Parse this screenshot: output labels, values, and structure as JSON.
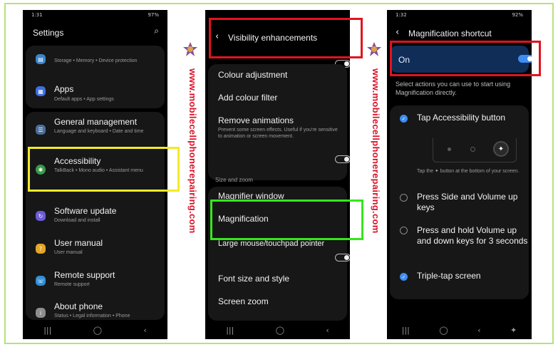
{
  "watermark": "www.mobilecellphonerepairing.com",
  "colors": {
    "highlight_yellow": "#f2ea2a",
    "highlight_green": "#35e61d",
    "highlight_red": "#e0141e",
    "accent_blue": "#3e8df2"
  },
  "phone1": {
    "status_time": "1:31",
    "status_right": "97%",
    "title": "Settings",
    "search_icon": "search-icon",
    "items": [
      {
        "icon": "storage-icon",
        "title": "",
        "subtitle": "Storage • Memory • Device protection",
        "color": "#3c86c9"
      },
      {
        "icon": "apps-icon",
        "title": "Apps",
        "subtitle": "Default apps • App settings",
        "color": "#3d6fe0"
      },
      {
        "icon": "general-management-icon",
        "title": "General management",
        "subtitle": "Language and keyboard • Date and time",
        "color": "#4b6f98"
      },
      {
        "icon": "accessibility-icon",
        "title": "Accessibility",
        "subtitle": "TalkBack • Mono audio • Assistant menu",
        "color": "#3a9a4a"
      },
      {
        "icon": "software-update-icon",
        "title": "Software update",
        "subtitle": "Download and install",
        "color": "#6d5bd6"
      },
      {
        "icon": "user-manual-icon",
        "title": "User manual",
        "subtitle": "User manual",
        "color": "#e5a624"
      },
      {
        "icon": "remote-support-icon",
        "title": "Remote support",
        "subtitle": "Remote support",
        "color": "#2f8fd8"
      },
      {
        "icon": "about-phone-icon",
        "title": "About phone",
        "subtitle": "Status • Legal information • Phone",
        "color": "#8e8e8e"
      }
    ],
    "nav": [
      "|||",
      "◯",
      "‹"
    ]
  },
  "phone2": {
    "status_time": "",
    "title": "Visibility enhancements",
    "back": "‹",
    "rows": [
      {
        "title": "Colour adjustment"
      },
      {
        "title": "Add colour filter"
      },
      {
        "title": "Remove animations",
        "subtitle": "Prevent some screen effects. Useful if you're sensitive to animation or screen movement."
      }
    ],
    "section": "Size and zoom",
    "magnifier_window": "Magnifier window",
    "magnification": "Magnification",
    "large_pointer": "Large mouse/touchpad pointer",
    "font_size": "Font size and style",
    "screen_zoom": "Screen zoom",
    "nav": [
      "|||",
      "◯",
      "‹"
    ]
  },
  "phone3": {
    "status_time": "1:32",
    "status_right": "92%",
    "title": "Magnification shortcut",
    "back": "‹",
    "on_label": "On",
    "description": "Select actions you can use to start using Magnification directly.",
    "options": [
      {
        "label": "Tap Accessibility button",
        "checked": true
      },
      {
        "label": "Press Side and Volume up keys",
        "checked": false
      },
      {
        "label": "Press and hold Volume up and down keys for 3 seconds",
        "checked": false
      },
      {
        "label": "Triple-tap screen",
        "checked": true
      }
    ],
    "tap_hint": "Tap the ✦ button at the bottom of your screen.",
    "nav": [
      "|||",
      "◯",
      "‹",
      "✦"
    ]
  }
}
